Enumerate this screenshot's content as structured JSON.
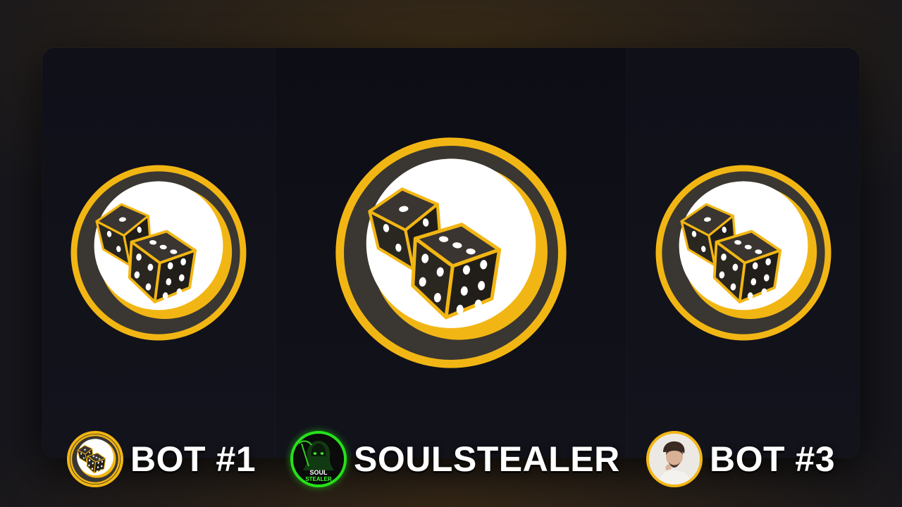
{
  "colors": {
    "gold": "#f2b614",
    "coin_dark": "#3a3732",
    "dice_body": "#2a2620",
    "pip": "#ffffff",
    "neon_green": "#26e21a",
    "background": "#16161c",
    "card": "#101019"
  },
  "slots": [
    {
      "icon": "dice-coin-icon",
      "highlighted": false
    },
    {
      "icon": "dice-coin-icon",
      "highlighted": true
    },
    {
      "icon": "dice-coin-icon",
      "highlighted": false
    }
  ],
  "players": [
    {
      "name": "BOT #1",
      "avatar": "dice-coin-avatar"
    },
    {
      "name": "SOULSTEALER",
      "avatar": "grim-reaper-logo-avatar",
      "logo_text_line1": "SOUL",
      "logo_text_line2": "STEALER"
    },
    {
      "name": "BOT #3",
      "avatar": "person-photo-avatar"
    }
  ]
}
